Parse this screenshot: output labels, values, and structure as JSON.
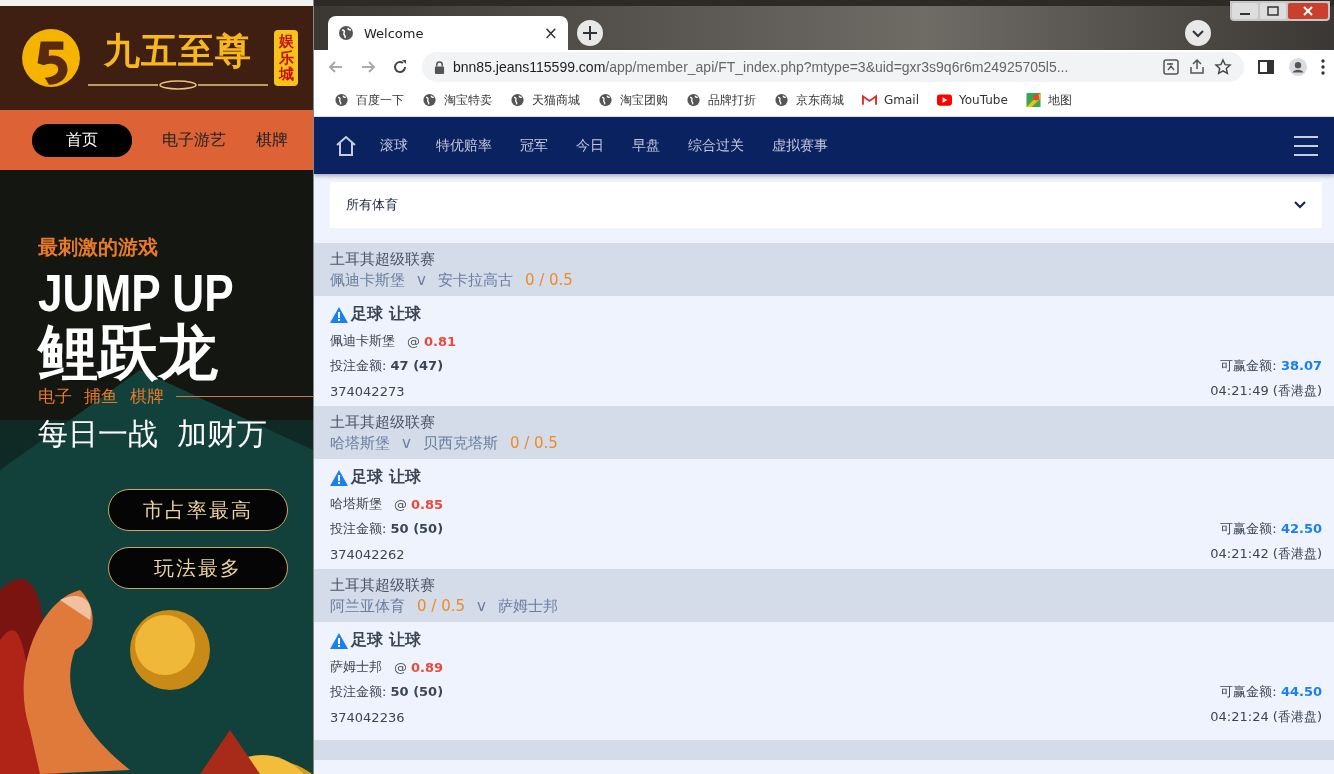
{
  "site": {
    "logo_title": "九五至尊",
    "logo_badge": "娱乐城",
    "nav": [
      {
        "label": "首页",
        "selected": true
      },
      {
        "label": "电子游艺",
        "selected": false
      },
      {
        "label": "棋牌",
        "selected": false
      }
    ],
    "banner": {
      "kicker": "最刺激的游戏",
      "headline": "JUMP UP",
      "title": "鲤跃龙",
      "tags": [
        "电子",
        "捕鱼",
        "棋牌"
      ],
      "slogan": "每日一战  加财万",
      "buttons": [
        "市占率最高",
        "玩法最多"
      ]
    }
  },
  "browser": {
    "tab": {
      "title": "Welcome",
      "close": "×"
    },
    "address": {
      "host": "bnn85.jeans115599.com",
      "path": "/app/member_api/FT_index.php?mtype=3&uid=gxr3s9q6r6m24925705l5..."
    },
    "bookmarks": [
      {
        "kind": "globe",
        "label": "百度一下"
      },
      {
        "kind": "globe",
        "label": "淘宝特卖"
      },
      {
        "kind": "globe",
        "label": "天猫商城"
      },
      {
        "kind": "globe",
        "label": "淘宝团购"
      },
      {
        "kind": "globe",
        "label": "品牌打折"
      },
      {
        "kind": "globe",
        "label": "京东商城"
      },
      {
        "kind": "mail",
        "label": "Gmail"
      },
      {
        "kind": "video",
        "label": "YouTube"
      },
      {
        "kind": "map",
        "label": "地图"
      }
    ]
  },
  "app": {
    "nav": [
      "滚球",
      "特优赔率",
      "冠军",
      "今日",
      "早盘",
      "综合过关",
      "虚拟赛事"
    ],
    "filter": {
      "value": "所有体育"
    },
    "bets": [
      {
        "league": "土耳其超级联赛",
        "match": [
          {
            "kind": "team",
            "text": "佩迪卡斯堡"
          },
          {
            "kind": "vs",
            "text": "v"
          },
          {
            "kind": "team",
            "text": "安卡拉高古"
          },
          {
            "kind": "handicap",
            "text": "0 / 0.5"
          }
        ],
        "title": "足球 让球",
        "selection": "佩迪卡斯堡",
        "at": "@",
        "odds": "0.81",
        "stake_label": "投注金额:",
        "stake": "47 (47)",
        "win_label": "可赢金额:",
        "win": "38.07",
        "ticket": "374042273",
        "time": "04:21:49 (香港盘)"
      },
      {
        "league": "土耳其超级联赛",
        "match": [
          {
            "kind": "team",
            "text": "哈塔斯堡"
          },
          {
            "kind": "vs",
            "text": "v"
          },
          {
            "kind": "team",
            "text": "贝西克塔斯"
          },
          {
            "kind": "handicap",
            "text": "0 / 0.5"
          }
        ],
        "title": "足球 让球",
        "selection": "哈塔斯堡",
        "at": "@",
        "odds": "0.85",
        "stake_label": "投注金额:",
        "stake": "50 (50)",
        "win_label": "可赢金额:",
        "win": "42.50",
        "ticket": "374042262",
        "time": "04:21:42 (香港盘)"
      },
      {
        "league": "土耳其超级联赛",
        "match": [
          {
            "kind": "team",
            "text": "阿兰亚体育"
          },
          {
            "kind": "handicap",
            "text": "0 / 0.5"
          },
          {
            "kind": "vs",
            "text": "v"
          },
          {
            "kind": "team",
            "text": "萨姆士邦"
          }
        ],
        "title": "足球 让球",
        "selection": "萨姆士邦",
        "at": "@",
        "odds": "0.89",
        "stake_label": "投注金额:",
        "stake": "50 (50)",
        "win_label": "可赢金额:",
        "win": "44.50",
        "ticket": "374042236",
        "time": "04:21:24 (香港盘)"
      }
    ]
  }
}
